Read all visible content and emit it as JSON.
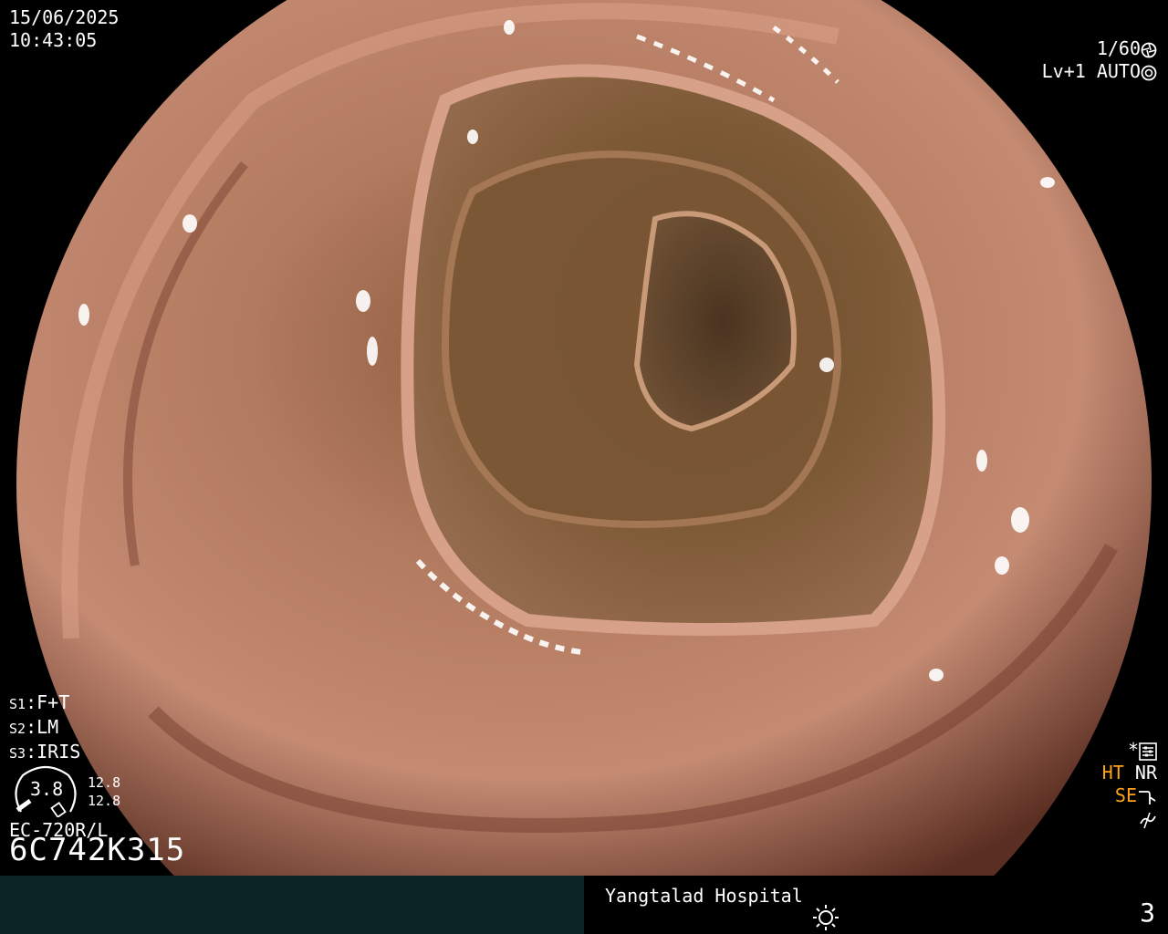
{
  "top_left": {
    "date": "15/06/2025",
    "time": "10:43:05"
  },
  "top_right": {
    "shutter": "1/60",
    "level": "Lv+1",
    "mode": "AUTO"
  },
  "settings": [
    {
      "key": "S1",
      "value": "F+T"
    },
    {
      "key": "S2",
      "value": "LM"
    },
    {
      "key": "S3",
      "value": "IRIS"
    }
  ],
  "iris": {
    "value": "3.8",
    "meter_top": "12.8",
    "meter_bottom": "12.8"
  },
  "scope": {
    "model": "EC-720R/L",
    "serial": "6C742K315"
  },
  "right_panel": {
    "ht": "HT",
    "nr": "NR",
    "se": "SE"
  },
  "footer": {
    "hospital": "Yangtalad Hospital",
    "page": "3"
  },
  "icons": [
    "aperture-icon",
    "camera-icon",
    "asterisk-icon",
    "settings-sliders-icon",
    "scope-arrow-icon",
    "zigzag-icon",
    "sun-icon"
  ],
  "colors": {
    "accent": "#ffa318",
    "footer_bar": "#0c2426"
  }
}
